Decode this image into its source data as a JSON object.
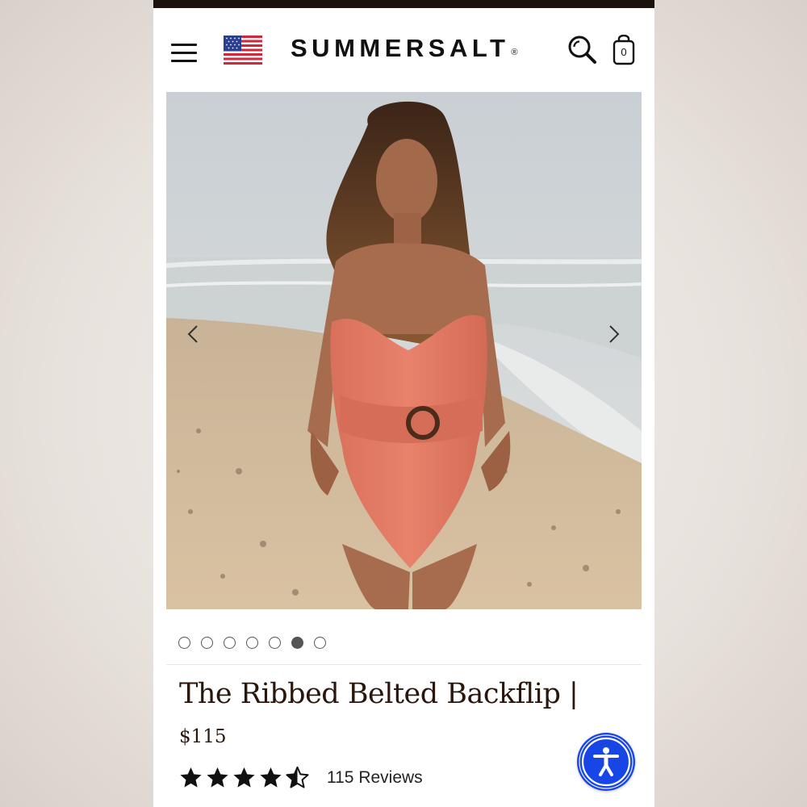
{
  "header": {
    "brand": "SUMMERSALT",
    "brand_mark": "®",
    "menu_icon": "hamburger-menu-icon",
    "flag_icon": "us-flag-icon",
    "search_icon": "search-icon",
    "cart_icon": "shopping-bag-icon",
    "cart_count": "0"
  },
  "gallery": {
    "image": "model-on-beach-in-coral-ribbed-belted-swimsuit",
    "prev_icon": "chevron-left-icon",
    "next_icon": "chevron-right-icon",
    "slide_count": 7,
    "active_slide": 6
  },
  "product": {
    "title": "The Ribbed Belted Backflip |",
    "price": "$115",
    "rating": 4.5,
    "rating_max": 5,
    "reviews_label": "115 Reviews"
  },
  "accessibility": {
    "icon": "accessibility-person-icon"
  },
  "colors": {
    "top_bar": "#1c120d",
    "title_text": "#2a160d",
    "accessibility_button": "#1846e6",
    "swimsuit": "#e07862"
  }
}
